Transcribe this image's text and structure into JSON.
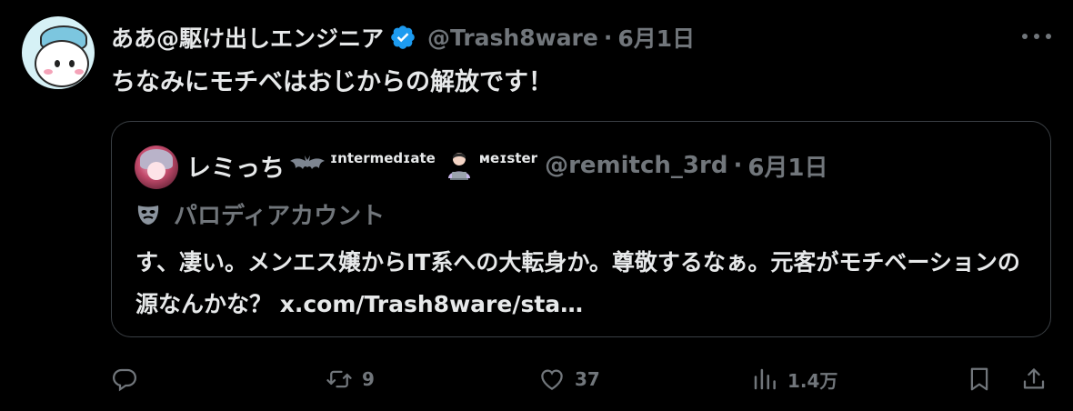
{
  "tweet": {
    "display_name": "ああ@駆け出しエンジニア",
    "handle": "@Trash8ware",
    "separator": "·",
    "date": "6月1日",
    "text": "ちなみにモチベはおじからの解放です！"
  },
  "quote": {
    "display_name": "レミっち",
    "badge_1": "ɪntermedɪate",
    "badge_2": "мeɪster",
    "handle": "@remitch_3rd",
    "separator": "·",
    "date": "6月1日",
    "parody_label": "パロディアカウント",
    "text": "す、凄い。メンエス嬢からIT系への大転身か。尊敬するなぁ。元客がモチベーションの源なんかな？ x.com/Trash8ware/sta…"
  },
  "actions": {
    "replies": "",
    "reposts": "9",
    "likes": "37",
    "views": "1.4万"
  },
  "colors": {
    "background": "#000000",
    "text_primary": "#e7e9ea",
    "text_secondary": "#71767b",
    "verified": "#1d9bf0",
    "border": "#3a3f44"
  },
  "icons": [
    "verified-badge-icon",
    "more-icon",
    "bat-icon",
    "laptop-person-icon",
    "mask-icon",
    "reply-icon",
    "repost-icon",
    "like-icon",
    "views-icon",
    "bookmark-icon",
    "share-icon"
  ]
}
